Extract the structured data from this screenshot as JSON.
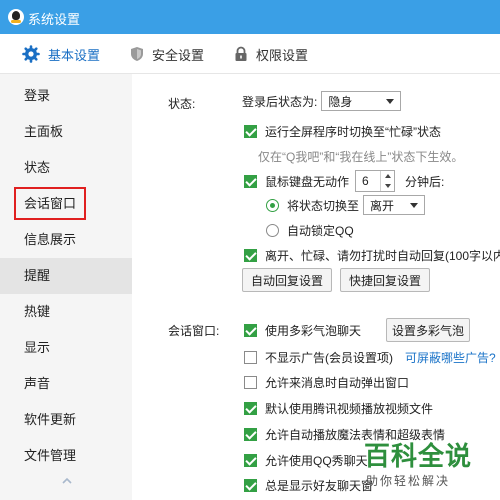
{
  "window": {
    "title": "系统设置"
  },
  "tabs": [
    {
      "label": "基本设置",
      "icon": "gear-icon",
      "active": true
    },
    {
      "label": "安全设置",
      "icon": "shield-icon",
      "active": false
    },
    {
      "label": "权限设置",
      "icon": "lock-icon",
      "active": false
    }
  ],
  "sidebar": {
    "items": [
      {
        "label": "登录"
      },
      {
        "label": "主面板"
      },
      {
        "label": "状态"
      },
      {
        "label": "会话窗口",
        "highlighted": true
      },
      {
        "label": "信息展示"
      },
      {
        "label": "提醒",
        "hover": true
      },
      {
        "label": "热键"
      },
      {
        "label": "显示"
      },
      {
        "label": "声音"
      },
      {
        "label": "软件更新"
      },
      {
        "label": "文件管理"
      }
    ],
    "scroll_icon": "chevron-up-icon"
  },
  "status_section": {
    "label": "状态:",
    "after_login_label": "登录后状态为:",
    "after_login_value": "隐身",
    "fullscreen_busy": {
      "checked": true,
      "label": "运行全屏程序时切换至“忙碌”状态"
    },
    "fullscreen_hint": "仅在“Q我吧”和“我在线上”状态下生效。",
    "idle": {
      "checked": true,
      "label": "鼠标键盘无动作",
      "minutes": "6",
      "suffix": "分钟后:"
    },
    "switch_to": {
      "selected": true,
      "label": "将状态切换至",
      "value": "离开"
    },
    "auto_lock": {
      "selected": false,
      "label": "自动锁定QQ"
    },
    "auto_reply": {
      "checked": true,
      "label": "离开、忙碌、请勿打扰时自动回复(100字以内"
    },
    "auto_reply_settings_button": "自动回复设置",
    "quick_reply_settings_button": "快捷回复设置"
  },
  "chat_section": {
    "label": "会话窗口:",
    "items": [
      {
        "checked": true,
        "label": "使用多彩气泡聊天"
      },
      {
        "checked": false,
        "label": "不显示广告(会员设置项)"
      },
      {
        "checked": false,
        "label": "允许来消息时自动弹出窗口"
      },
      {
        "checked": true,
        "label": "默认使用腾讯视频播放视频文件"
      },
      {
        "checked": true,
        "label": "允许自动播放魔法表情和超级表情"
      },
      {
        "checked": true,
        "label": "允许使用QQ秀聊天"
      },
      {
        "checked": true,
        "label": "总是显示好友聊天窗"
      }
    ],
    "bubble_settings_button": "设置多彩气泡",
    "ad_link": "可屏蔽哪些广告?"
  },
  "watermark": {
    "brand": "百科全说",
    "sub": "助你轻松解决"
  },
  "colors": {
    "titlebar": "#3a9fe6",
    "accent": "#1a6fc4",
    "check_green": "#33a044",
    "highlight_red": "#e02020",
    "link": "#1a73c8"
  }
}
